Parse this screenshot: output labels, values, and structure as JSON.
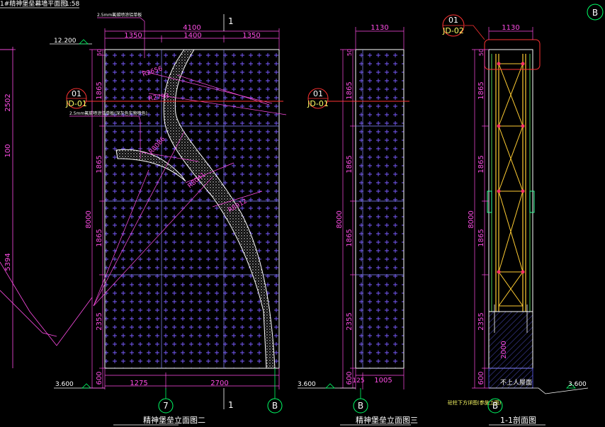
{
  "header": {
    "drawing_title": "1#精神堡垒幕墙平面图",
    "scale": "1:58"
  },
  "view1": {
    "title": "精神堡垒立面图二",
    "top_dims": [
      "1350",
      "1400",
      "1350"
    ],
    "total_width": "4100",
    "bottom_dims": [
      "1275",
      "2700"
    ],
    "left_dims": [
      "50",
      "1865",
      "1865",
      "1865",
      "2355",
      "600"
    ],
    "total_height": "8000",
    "elev_top": "12.200",
    "elev_bottom": "3.600",
    "radius_labels": [
      "R2656",
      "R2793",
      "R8086",
      "R8041",
      "R8912"
    ],
    "note1": "2.5mm氟碳喷涂铝单板",
    "note2": "2.5mm氟碳喷涂铝单板(深灰色实物喷色)",
    "tag": {
      "top": "01",
      "bottom": "JD-01"
    },
    "section_mark": "1",
    "grid_left": "7",
    "grid_right": "B"
  },
  "view0": {
    "dims": [
      "2502",
      "100",
      "5394"
    ]
  },
  "view2": {
    "title": "精神堡垒立面图三",
    "top_dim": "1130",
    "bottom_dims": [
      "125",
      "1005"
    ],
    "left_dims": [
      "50",
      "1865",
      "1865",
      "1865",
      "2355",
      "600"
    ],
    "total_height": "8000",
    "elev_bottom": "3.600",
    "tag": {
      "top": "01",
      "bottom": "JD-01"
    },
    "grid": "B"
  },
  "view3": {
    "title": "1-1剖面图",
    "top_dim": "1130",
    "left_dims": [
      "50",
      "1865",
      "1865",
      "1865",
      "2355",
      "600"
    ],
    "total_height": "8000",
    "base_dim": "2000",
    "elev_bottom": "3.600",
    "callout": {
      "top": "01",
      "bottom": "JD-02"
    },
    "grid": "B",
    "grid_top": "B",
    "ground_note": "不上人屋面",
    "base_note": "砼柱下方详图(参施工图)"
  }
}
